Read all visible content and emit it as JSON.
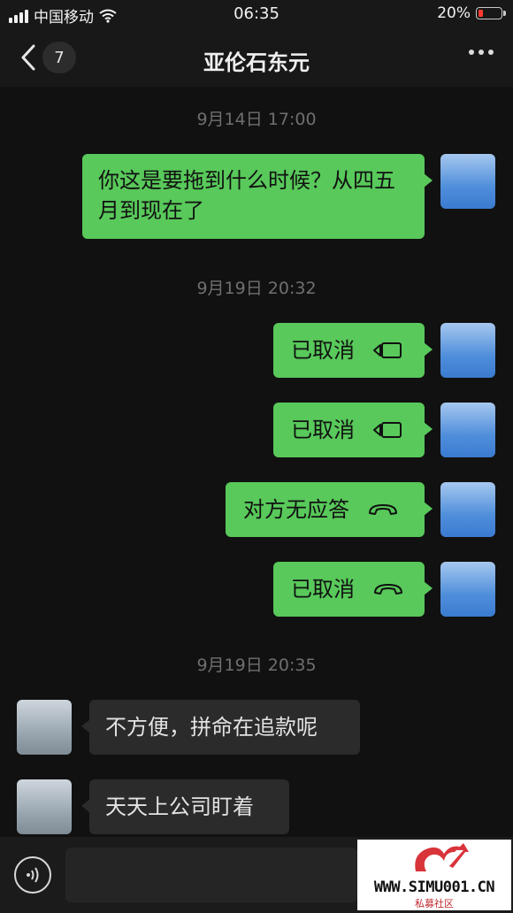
{
  "status_bar": {
    "carrier": "中国移动",
    "time": "06:35",
    "battery": "20%",
    "battery_level": 0.2
  },
  "header": {
    "unread_count": "7",
    "title": "亚伦石东元"
  },
  "messages": [
    {
      "type": "timestamp",
      "text": "9月14日 17:00"
    },
    {
      "type": "text",
      "side": "self",
      "text": "你这是要拖到什么时候？从四五月到现在了"
    },
    {
      "type": "timestamp",
      "text": "9月19日 20:32"
    },
    {
      "type": "call",
      "side": "self",
      "text": "已取消",
      "icon": "video-call-icon"
    },
    {
      "type": "call",
      "side": "self",
      "text": "已取消",
      "icon": "video-call-icon"
    },
    {
      "type": "call",
      "side": "self",
      "text": "对方无应答",
      "icon": "phone-hangup-icon"
    },
    {
      "type": "call",
      "side": "self",
      "text": "已取消",
      "icon": "phone-hangup-icon"
    },
    {
      "type": "timestamp",
      "text": "9月19日 20:35"
    },
    {
      "type": "text",
      "side": "other",
      "text": "不方便，拼命在追款呢"
    },
    {
      "type": "text",
      "side": "other",
      "text": "天天上公司盯着"
    }
  ],
  "input": {
    "value": "",
    "placeholder": ""
  },
  "watermark": {
    "site": "WWW.SIMU001.CN",
    "sub": "私募社区"
  },
  "colors": {
    "self_bubble": "#58c95a",
    "other_bubble": "#2b2b2b",
    "background": "#111111"
  }
}
